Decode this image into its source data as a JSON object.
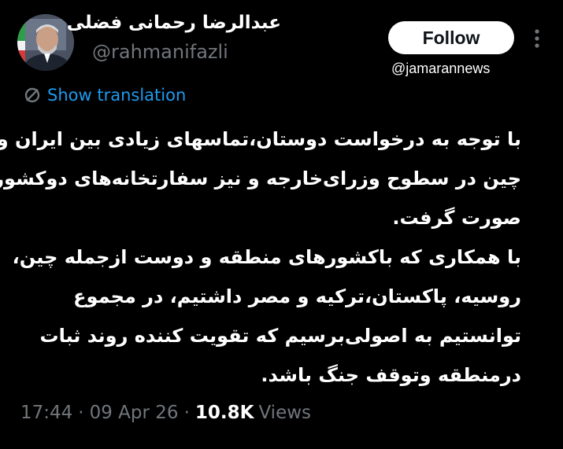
{
  "author": {
    "display_name": "عبدالرضا رحمانی فضلی",
    "handle": "@rahmanifazli"
  },
  "follow_button": {
    "label": "Follow"
  },
  "watermark": "@jamarannews",
  "translation": {
    "label": "Show translation"
  },
  "tweet": {
    "lines": [
      "با توجه به درخواست دوستان،تماسهای زیادی بین ایران و",
      "چین در سطوح وزرای‌خارجه و نیز سفارتخانه‌های دوکشور",
      "صورت گرفت.",
      "با همکاری که باکشورهای منطقه و دوست ازجمله چین،",
      "روسیه، پاکستان،ترکیه و مصر داشتیم، در مجموع",
      "توانستیم به اصولی‌برسیم که تقویت کننده روند ثبات",
      "درمنطقه وتوقف جنگ باشد."
    ]
  },
  "meta": {
    "time": "17:44",
    "date": "09 Apr 26",
    "separator": "·",
    "views_count": "10.8K",
    "views_label": "Views"
  },
  "icons": {
    "more": "more-vertical-icon",
    "translate": "translate-icon"
  },
  "colors": {
    "background": "#000000",
    "link_blue": "#1d9bf0",
    "secondary_text": "#71767b",
    "primary_text": "#ffffff"
  }
}
